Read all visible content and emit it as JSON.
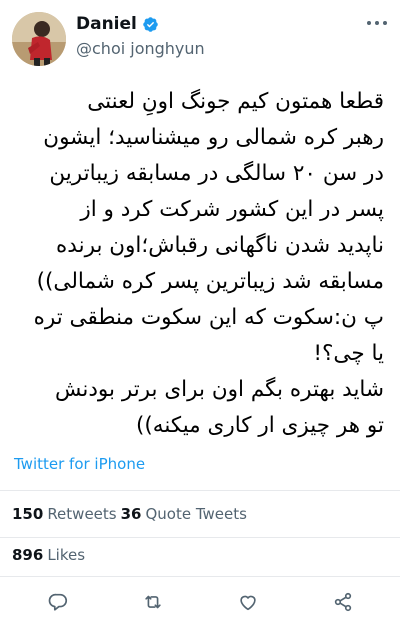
{
  "author": {
    "display_name": "Daniel",
    "handle": "@choi jonghyun"
  },
  "tweet": {
    "lines": [
      "قطعا همتون کیم جونگ اونِ لعنتی",
      "رهبر کره شمالی رو میشناسید؛ ایشون",
      "در سن ۲۰ سالگی در مسابقه زیباترین",
      "پسر در این کشور شرکت کرد و از",
      "ناپدید شدن ناگهانی رقباش؛اون برنده",
      "مسابقه شد زیباترین پسر کره شمالی))",
      "پ ن:سکوت که این سکوت منطقی تره",
      "یا چی؟!",
      "شاید بهتره بگم اون برای برتر بودنش",
      "تو هر چیزی ار کاری میکنه))"
    ],
    "source": "Twitter for iPhone"
  },
  "stats": {
    "retweets_count": "150",
    "retweets_label": "Retweets",
    "quote_count": "36",
    "quote_label": "Quote Tweets",
    "likes_count": "896",
    "likes_label": "Likes"
  },
  "icons": {
    "verified": "verified-badge-icon",
    "more": "more-options-icon",
    "reply": "reply-icon",
    "retweet": "retweet-icon",
    "like": "like-icon",
    "share": "share-icon"
  },
  "colors": {
    "accent": "#1d9bf0",
    "secondary_text": "#536471",
    "icon": "#536471"
  }
}
